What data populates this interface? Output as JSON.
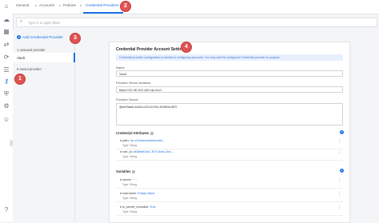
{
  "tabs": [
    "General",
    "Accounts",
    "Policies",
    "Credential Providers"
  ],
  "search": {
    "placeholder": "Type in to apply filters"
  },
  "left": {
    "add_label": "Add Credential Provider",
    "group_unsaved": "1 unsaved provider",
    "group_saved": "8 saved provider",
    "selected_item": "Vault"
  },
  "panel": {
    "title": "Credential Provider Account Settings",
    "info": "Credential provider configuration is similar to configuring accounts. You may add the configured Credential provider to projects.",
    "name_label": "Name",
    "name_value": "Vault",
    "address_label": "Provider Server Address",
    "address_value": "https://10.45.100.160:vip.io/v1",
    "secret_label": "Provider Secret",
    "secret_value": "@ebf3add-ea28-c224-b7b0-4030f9c367f",
    "attr_section": "Credential Attributes",
    "attrs": [
      {
        "key": "# path:",
        "val": "/kv-v2/calmvault/secrets...",
        "type": "Type: String"
      },
      {
        "key": "# role_id:",
        "val": "a93b6eb3e1-7b7f-8cb4-1bb...",
        "type": "Type: String"
      }
    ],
    "var_section": "Variables",
    "vars": [
      {
        "key": "# secret:",
        "val": "·····",
        "type": "Type: String"
      },
      {
        "key": "# username:",
        "val": "Empty Value",
        "type": "Type: String"
      },
      {
        "key": "# is_secret_encoded:",
        "val": "True",
        "type": "Type: String"
      }
    ]
  },
  "callouts": [
    "1",
    "2",
    "3",
    "4"
  ],
  "colors": {
    "accent": "#1a73e8",
    "callout": "#e05353"
  }
}
